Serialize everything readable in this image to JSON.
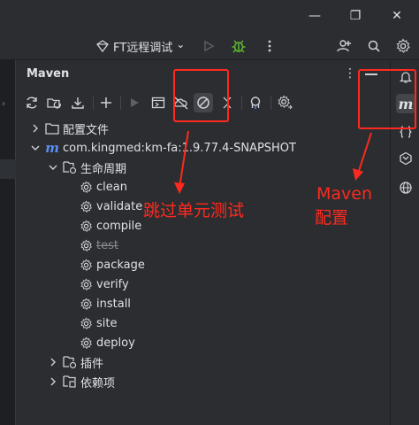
{
  "window": {
    "minimize_glyph": "—",
    "restore_glyph": "❐",
    "close_glyph": "✕"
  },
  "toolbar": {
    "run_config_label": "FT远程调试",
    "run_config_chevron": "⌄"
  },
  "panel": {
    "title": "Maven",
    "menu_glyph": "⋮"
  },
  "tree": {
    "config_files": "配置文件",
    "project": "com.kingmed:km-fa:1.9.77.4-SNAPSHOT",
    "lifecycle": "生命周期",
    "phases": [
      "clean",
      "validate",
      "compile",
      "test",
      "package",
      "verify",
      "install",
      "site",
      "deploy"
    ],
    "skipped_phase": "test",
    "plugins": "插件",
    "dependencies": "依赖项"
  },
  "annotations": {
    "skip_tests_label": "跳过单元测试",
    "maven_config_line1": "Maven",
    "maven_config_line2": "配置"
  },
  "colors": {
    "background": "#2b2d30",
    "text": "#dfe1e5",
    "annotation": "#ff2a1f",
    "bug_green": "#5fb832",
    "maven_blue": "#5b8ef0"
  }
}
